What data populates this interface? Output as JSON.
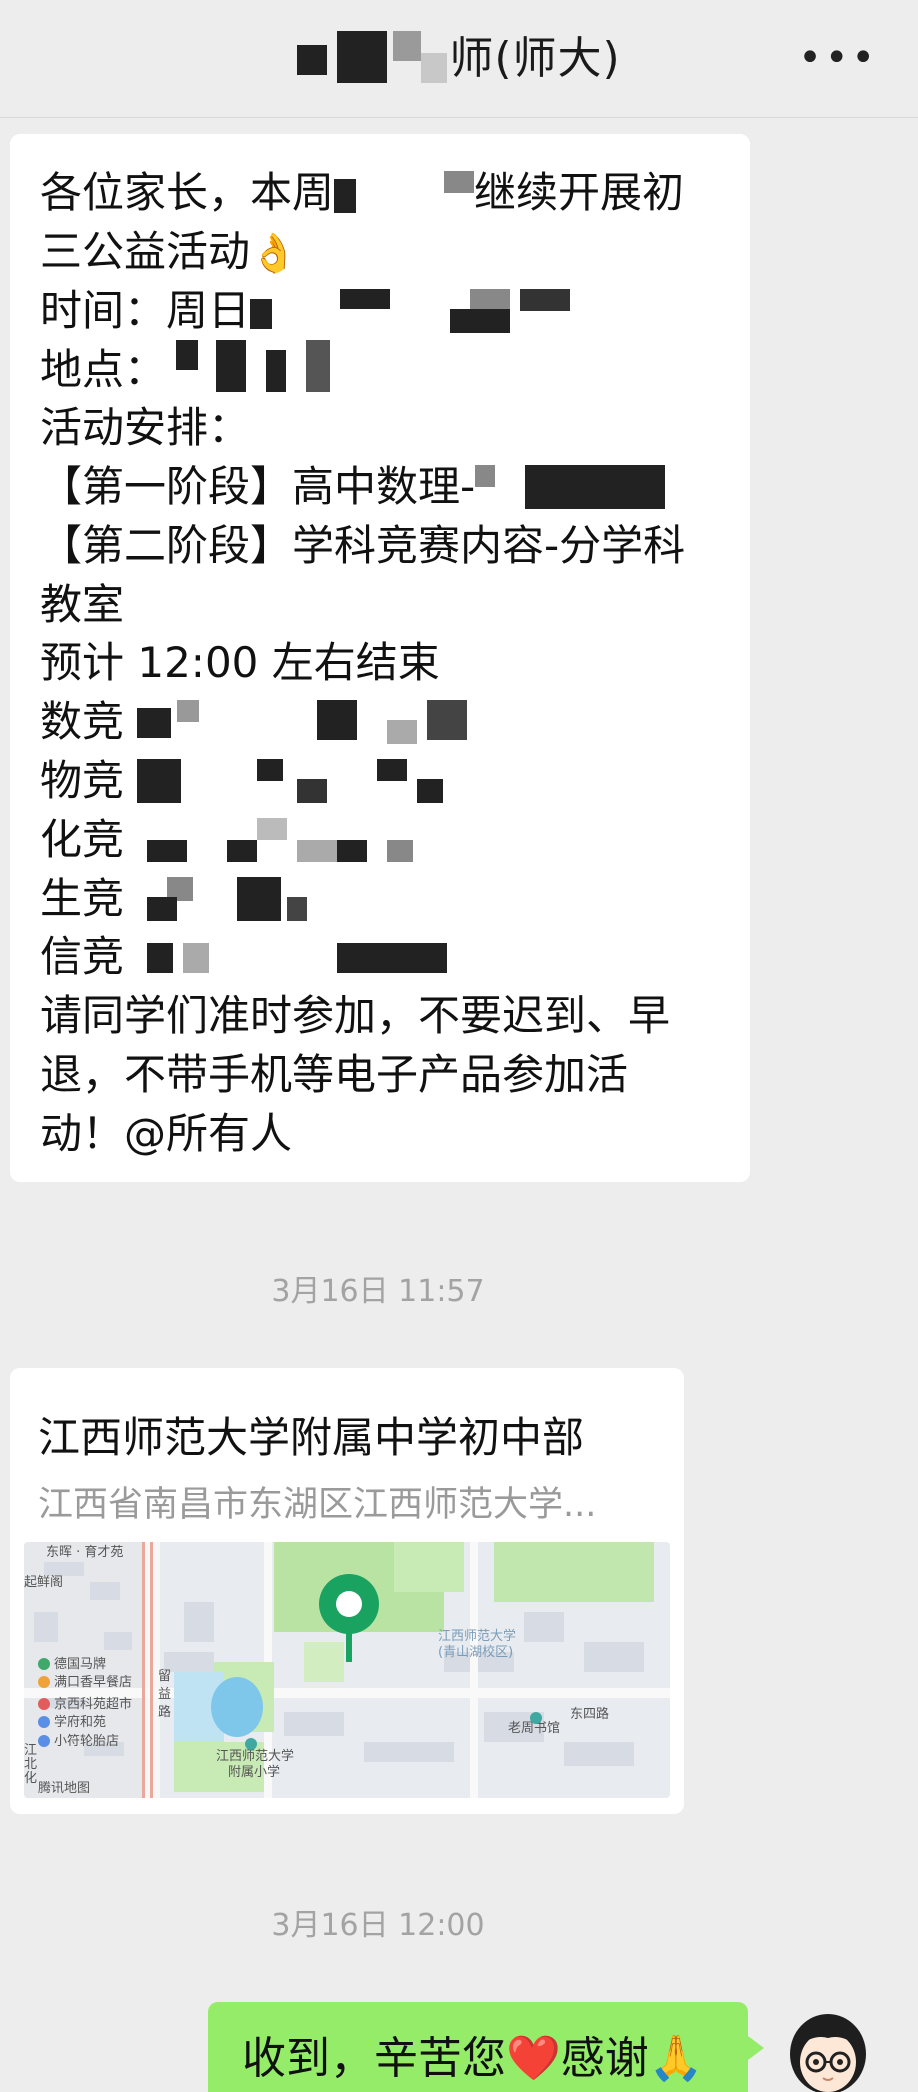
{
  "header": {
    "title_suffix": "师(师大)",
    "more_icon": "more-dots-icon"
  },
  "message1": {
    "line1_a": "各位家长，本周",
    "line1_b": "继续开展初",
    "line2": "三公益活动",
    "line2_emoji": "👌",
    "line3": "时间：周日",
    "line4": "地点：",
    "line5": "活动安排：",
    "line6": "【第一阶段】高中数理-",
    "line7": "【第二阶段】学科竞赛内容-分学科",
    "line8": "教室",
    "line9": "预计 12:00 左右结束",
    "line10": "数竞",
    "line11": "物竞",
    "line12": "化竞",
    "line13": "生竞",
    "line14": "信竞",
    "line15": "请同学们准时参加，不要迟到、早",
    "line16": "退，不带手机等电子产品参加活",
    "line17": "动！@所有人"
  },
  "timestamps": {
    "t1": "3月16日 11:57",
    "t2": "3月16日 12:00"
  },
  "location": {
    "name": "江西师范大学附属中学初中部",
    "address": "江西省南昌市东湖区江西师范大学...",
    "map_labels": {
      "l1": "东晖 · 育才苑",
      "l2": "起鲜阁",
      "l3": "德国马牌",
      "l4": "满口香早餐店",
      "l5": "京西科苑超市",
      "l6": "学府和苑",
      "l7": "小符轮胎店",
      "l8": "腾讯地图",
      "l9": "留",
      "l10": "益",
      "l11": "路",
      "l12": "江西师范大学",
      "l13": "(青山湖校区)",
      "l14": "东四路",
      "l15": "老周书馆",
      "l16": "江西师范大学",
      "l17": "附属小学",
      "l18": "江",
      "l19": "北",
      "l20": "化"
    }
  },
  "outgoing": {
    "text_a": "收到，辛苦您",
    "heart": "❤️",
    "text_b": "感谢",
    "hands": "🙏"
  },
  "colors": {
    "chat_bg": "#ededed",
    "bubble_in": "#ffffff",
    "bubble_out": "#95ec69",
    "timestamp": "#a3a3a3",
    "map_pin": "#1aa260"
  }
}
